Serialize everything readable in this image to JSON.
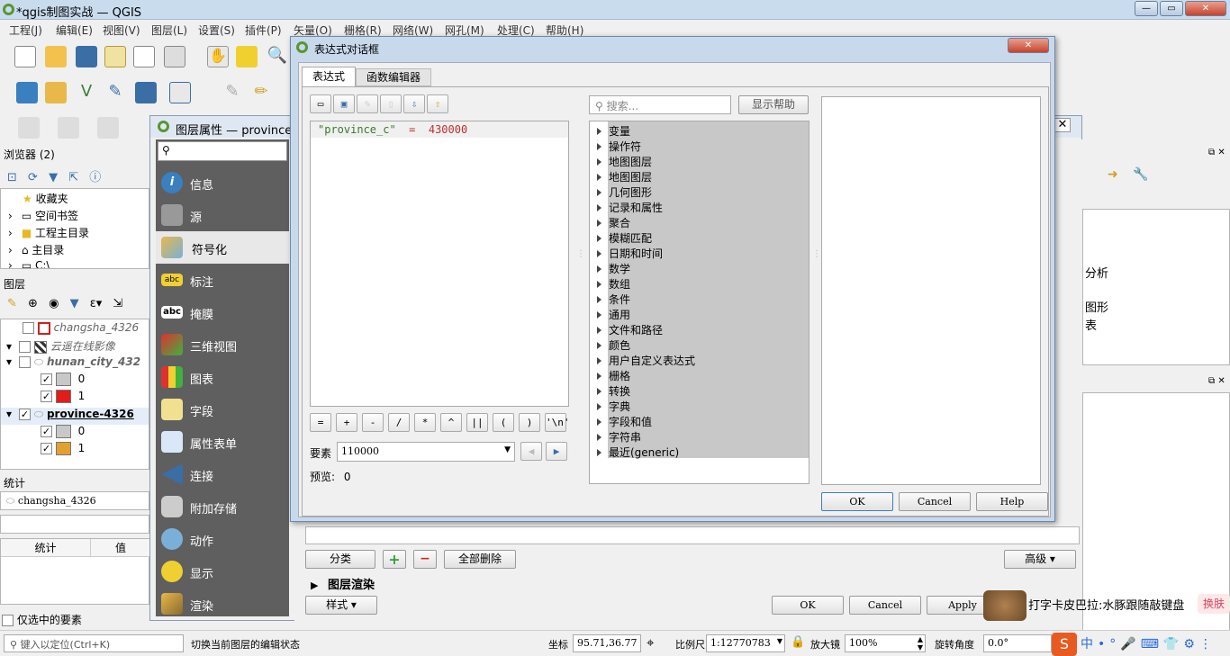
{
  "window": {
    "title": "*qgis制图实战 — QGIS"
  },
  "menu": [
    "工程(J)",
    "编辑(E)",
    "视图(V)",
    "图层(L)",
    "设置(S)",
    "插件(P)",
    "矢量(O)",
    "栅格(R)",
    "网络(W)",
    "网孔(M)",
    "处理(C)",
    "帮助(H)"
  ],
  "browser": {
    "title": "浏览器 (2)",
    "items": [
      "收藏夹",
      "空间书签",
      "工程主目录",
      "主目录",
      "C:\\"
    ]
  },
  "layers": {
    "title": "图层",
    "rows": [
      {
        "name": "changsha_4326"
      },
      {
        "name": "云遥在线影像"
      },
      {
        "name": "hunan_city_432"
      },
      {
        "name": "0"
      },
      {
        "name": "1"
      },
      {
        "name": "province-4326"
      },
      {
        "name": "0"
      },
      {
        "name": "1"
      }
    ]
  },
  "stats": {
    "title": "统计",
    "layer": "changsha_4326",
    "col1": "统计",
    "col2": "值",
    "only_selected": "仅选中的要素"
  },
  "props": {
    "title": "图层属性 — province-4",
    "items": [
      "信息",
      "源",
      "符号化",
      "标注",
      "掩膜",
      "三维视图",
      "图表",
      "字段",
      "属性表单",
      "连接",
      "附加存储",
      "动作",
      "显示",
      "渲染"
    ],
    "classify": "分类",
    "delete_all": "全部删除",
    "advanced": "高级",
    "layer_render": "图层渲染",
    "style": "样式",
    "ok": "OK",
    "cancel": "Cancel",
    "apply": "Apply"
  },
  "dialog": {
    "title": "表达式对话框",
    "tabs": [
      "表达式",
      "函数编辑器"
    ],
    "expr_field": "\"province_c\"",
    "expr_op": "=",
    "expr_val": "430000",
    "ops": [
      "=",
      "+",
      "-",
      "/",
      "*",
      "^",
      "||",
      "(",
      ")",
      "'\\n'"
    ],
    "feature_label": "要素",
    "feature_value": "110000",
    "preview_label": "预览:",
    "preview_value": "0",
    "search_placeholder": "搜索...",
    "show_help": "显示帮助",
    "groups": [
      "变量",
      "操作符",
      "地图图层",
      "地图图层",
      "几何图形",
      "记录和属性",
      "聚合",
      "模糊匹配",
      "日期和时间",
      "数学",
      "数组",
      "条件",
      "通用",
      "文件和路径",
      "颜色",
      "用户自定义表达式",
      "栅格",
      "转换",
      "字典",
      "字段和值",
      "字符串",
      "最近(generic)"
    ],
    "ok": "OK",
    "cancel": "Cancel",
    "help": "Help"
  },
  "right": {
    "texts": [
      "分析",
      "图形",
      "表"
    ]
  },
  "ime": {
    "text": "打字卡皮巴拉:水豚跟随敲键盘",
    "skin": "换肤"
  },
  "statusbar": {
    "locate_placeholder": "键入以定位(Ctrl+K)",
    "msg": "切换当前图层的编辑状态",
    "coord_label": "坐标",
    "coord": "95.71,36.77",
    "scale_label": "比例尺",
    "scale": "1:12770783",
    "mag_label": "放大镜",
    "mag": "100%",
    "rot_label": "旋转角度",
    "rot": "0.0°"
  }
}
